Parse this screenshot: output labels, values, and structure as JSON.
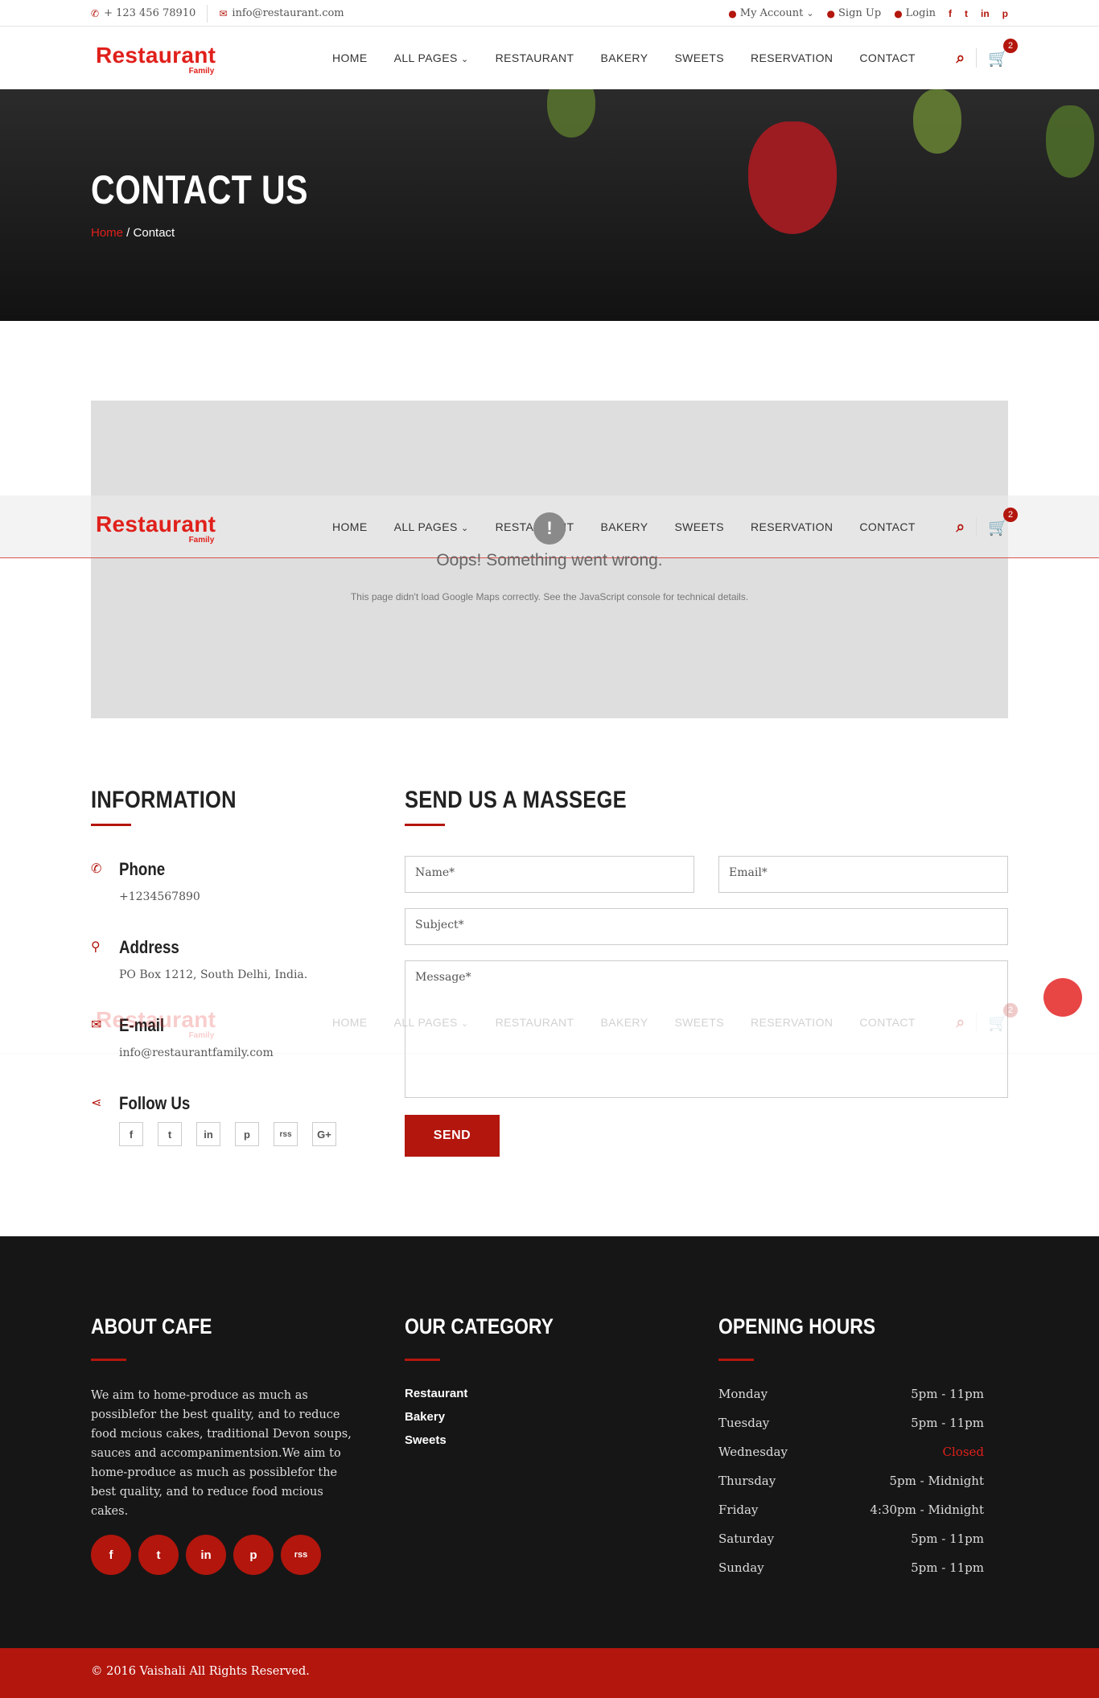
{
  "topbar": {
    "phone": "+ 123 456 78910",
    "email": "info@restaurant.com",
    "my_account": "My Account",
    "sign_up": "Sign Up",
    "login": "Login",
    "social": [
      "f",
      "t",
      "in",
      "p"
    ]
  },
  "logo": {
    "name": "Restaurant",
    "sub": "Family"
  },
  "nav": {
    "items": [
      "HOME",
      "ALL PAGES",
      "RESTAURANT",
      "BAKERY",
      "SWEETS",
      "RESERVATION",
      "CONTACT"
    ],
    "dropdown_arrow": "⌄"
  },
  "cart": {
    "count": "2"
  },
  "banner": {
    "title": "CONTACT US",
    "breadcrumb_home": "Home",
    "breadcrumb_sep": " / ",
    "breadcrumb_current": "Contact"
  },
  "map": {
    "error_title": "Oops! Something went wrong.",
    "error_text": "This page didn't load Google Maps correctly. See the JavaScript console for technical details.",
    "error_icon": "!"
  },
  "info": {
    "title": "INFORMATION",
    "phone_title": "Phone",
    "phone_value": "+1234567890",
    "address_title": "Address",
    "address_value": "PO Box 1212, South Delhi, India.",
    "email_title": "E-mail",
    "email_value": "info@restaurantfamily.com",
    "follow_title": "Follow Us",
    "follow_icons": [
      "f",
      "t",
      "in",
      "p",
      "rss",
      "G+"
    ]
  },
  "form": {
    "title": "SEND US A MASSEGE",
    "name_placeholder": "Name*",
    "email_placeholder": "Email*",
    "subject_placeholder": "Subject*",
    "message_placeholder": "Message*",
    "send_label": "SEND"
  },
  "footer": {
    "about_title": "ABOUT CAFE",
    "about_text": "We aim to home-produce as much as possiblefor the best quality, and to reduce food mcious cakes, traditional Devon soups, sauces and accompanimentsion.We aim to home-produce as much as possiblefor the best quality, and to reduce food mcious cakes.",
    "about_social": [
      "f",
      "t",
      "in",
      "p",
      "rss"
    ],
    "category_title": "OUR CATEGORY",
    "categories": [
      "Restaurant",
      "Bakery",
      "Sweets"
    ],
    "hours_title": "OPENING HOURS",
    "hours": [
      {
        "day": "Monday",
        "time": "5pm - 11pm"
      },
      {
        "day": "Tuesday",
        "time": "5pm - 11pm"
      },
      {
        "day": "Wednesday",
        "time": "Closed"
      },
      {
        "day": "Thursday",
        "time": "5pm - Midnight"
      },
      {
        "day": "Friday",
        "time": "4:30pm - Midnight"
      },
      {
        "day": "Saturday",
        "time": "5pm - 11pm"
      },
      {
        "day": "Sunday",
        "time": "5pm - 11pm"
      }
    ],
    "copyright": "© 2016 Vaishali All Rights Reserved."
  },
  "colors": {
    "accent": "#b3160d",
    "logo_red": "#e0201b",
    "cart_orange": "#e8a33a",
    "footer_bg": "#161616"
  },
  "icons": {
    "phone": "phone-icon",
    "envelope": "envelope-icon",
    "user": "user-icon",
    "search": "search-icon",
    "cart": "cart-icon",
    "map_marker": "map-marker-icon",
    "share": "share-icon"
  }
}
